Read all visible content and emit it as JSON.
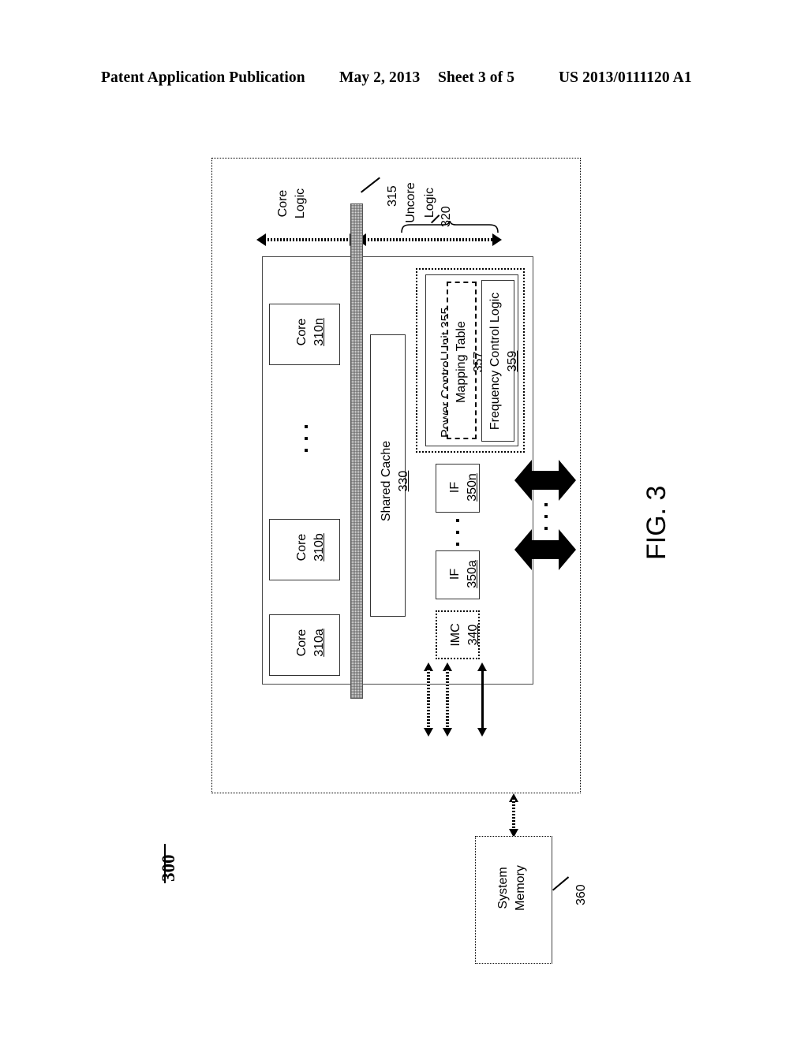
{
  "header": {
    "title": "Patent Application Publication",
    "date": "May 2, 2013",
    "sheet": "Sheet 3 of 5",
    "number": "US 2013/0111120 A1"
  },
  "figure": {
    "label": "FIG. 3",
    "system_ref": "300",
    "region_labels": {
      "core_logic": "Core\nLogic",
      "core_logic_line1": "Core",
      "core_logic_line2": "Logic",
      "uncore_logic_line1": "Uncore",
      "uncore_logic_line2": "Logic",
      "uncore_ref": "320",
      "interconnect_ref": "315"
    },
    "blocks": [
      {
        "id": "core_a",
        "name": "Core",
        "ref": "310a"
      },
      {
        "id": "core_b",
        "name": "Core",
        "ref": "310b"
      },
      {
        "id": "core_n",
        "name": "Core",
        "ref": "310n"
      },
      {
        "id": "cache",
        "name": "Shared Cache",
        "ref": "330"
      },
      {
        "id": "pcu",
        "name": "Power Control Unit",
        "ref": "355"
      },
      {
        "id": "mapping",
        "name": "Mapping Table",
        "ref": "357"
      },
      {
        "id": "freq",
        "name": "Frequency Control Logic",
        "ref": "359"
      },
      {
        "id": "imc",
        "name": "IMC",
        "ref": "340"
      },
      {
        "id": "if_a",
        "name": "IF",
        "ref": "350a"
      },
      {
        "id": "if_n",
        "name": "IF",
        "ref": "350n"
      },
      {
        "id": "sysmem",
        "name": "System\nMemory",
        "ref": "360"
      }
    ],
    "sysmem_line1": "System",
    "sysmem_line2": "Memory",
    "ellipsis": "· · ·"
  }
}
